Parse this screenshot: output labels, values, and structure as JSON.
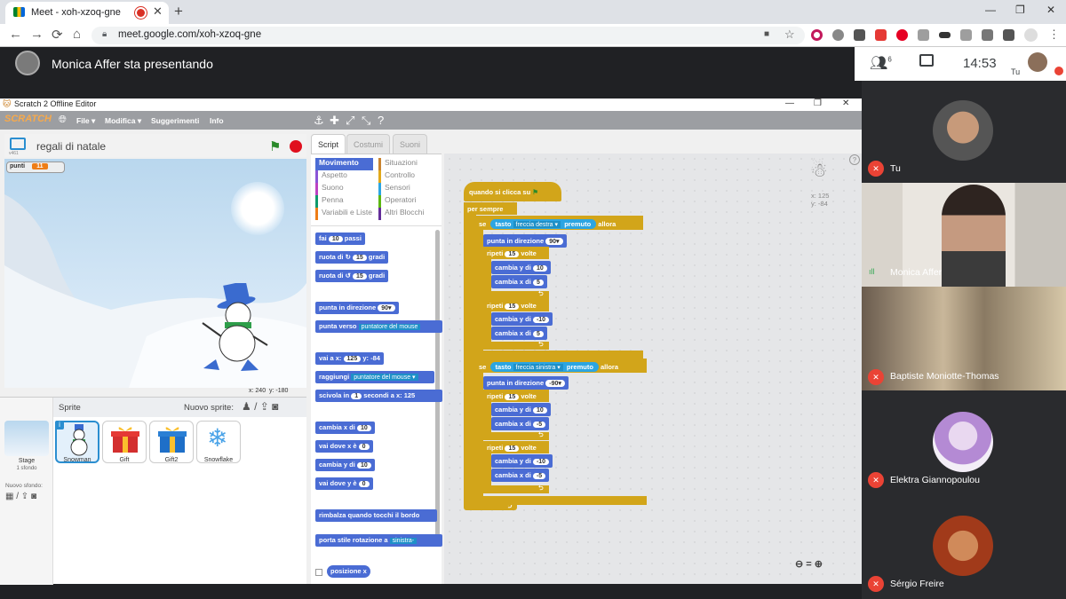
{
  "browser": {
    "tab_title": "Meet - xoh-xzoq-gne",
    "tab_close": "✕",
    "new_tab": "+",
    "url": "meet.google.com/xoh-xzoq-gne",
    "window_controls": [
      "—",
      "❐",
      "✕"
    ],
    "nav": [
      "←",
      "→",
      "⟳",
      "⌂"
    ]
  },
  "meet": {
    "presenting_text": "Monica Affer sta presentando",
    "participant_count": "6",
    "clock": "14:53",
    "self_label": "Tu",
    "participants": [
      {
        "name": "Tu",
        "muted": true
      },
      {
        "name": "Monica Affer",
        "muted": false
      },
      {
        "name": "Baptiste Moniotte-Thomas",
        "muted": true
      },
      {
        "name": "Elektra Giannopoulou",
        "muted": true
      },
      {
        "name": "Sérgio Freire",
        "muted": true
      }
    ]
  },
  "scratch": {
    "window_title": "Scratch 2 Offline Editor",
    "logo": "SCRATCH",
    "menus": [
      "File ▾",
      "Modifica ▾",
      "Suggerimenti",
      "Info"
    ],
    "project_name": "regali di natale",
    "version": "v461",
    "variable": {
      "name": "punti",
      "value": "11"
    },
    "stage_coords": {
      "x_label": "x:",
      "x": "240",
      "y_label": "y:",
      "y": "-180"
    },
    "sprite_header": "Sprite",
    "new_sprite": "Nuovo sprite:",
    "stage_label": "Stage",
    "stage_sub": "1 sfondo",
    "new_backdrop": "Nuovo sfondo:",
    "sprites": [
      "Snowman",
      "Gift",
      "Gift2",
      "Snowflake"
    ],
    "tabs": [
      "Script",
      "Costumi",
      "Suoni"
    ],
    "categories_left": [
      "Movimento",
      "Aspetto",
      "Suono",
      "Penna",
      "Variabili e Liste"
    ],
    "categories_right": [
      "Situazioni",
      "Controllo",
      "Sensori",
      "Operatori",
      "Altri Blocchi"
    ],
    "category_colors": {
      "Movimento": "#4a6cd4",
      "Aspetto": "#8a55d7",
      "Suono": "#bb42c3",
      "Penna": "#0e9a6c",
      "Variabili e Liste": "#ee7d16",
      "Situazioni": "#c88330",
      "Controllo": "#e1a91a",
      "Sensori": "#2ca5e2",
      "Operatori": "#5cb712",
      "Altri Blocchi": "#632d99"
    },
    "palette_blocks": [
      {
        "text": "fai",
        "input": "10",
        "suffix": "passi"
      },
      {
        "text": "ruota di ↻",
        "input": "15",
        "suffix": "gradi"
      },
      {
        "text": "ruota di ↺",
        "input": "15",
        "suffix": "gradi"
      },
      {
        "text": "punta in direzione",
        "input": "90▾",
        "suffix": ""
      },
      {
        "text": "punta verso",
        "input": "puntatore del mouse",
        "suffix": ""
      },
      {
        "text": "vai a x:",
        "input": "125",
        "suffix": "y: -84"
      },
      {
        "text": "raggiungi",
        "input": "puntatore del mouse ▾",
        "suffix": ""
      },
      {
        "text": "scivola in",
        "input": "1",
        "suffix": "secondi a x: 125"
      },
      {
        "text": "cambia x di",
        "input": "10",
        "suffix": ""
      },
      {
        "text": "vai dove x è",
        "input": "0",
        "suffix": ""
      },
      {
        "text": "cambia y di",
        "input": "10",
        "suffix": ""
      },
      {
        "text": "vai dove y è",
        "input": "0",
        "suffix": ""
      },
      {
        "text": "rimbalza quando tocchi il bordo",
        "input": "",
        "suffix": ""
      },
      {
        "text": "porta stile rotazione a",
        "input": "sinistra-",
        "suffix": ""
      },
      {
        "text": "posizione x",
        "input": "",
        "suffix": ""
      }
    ],
    "sprite_xy": {
      "x": "x: 125",
      "y": "y: -84"
    },
    "script": {
      "hat": "quando si clicca su",
      "forever": "per sempre",
      "if1": {
        "kw": "se",
        "sensor": "tasto",
        "key": "freccia destra ▾",
        "pressed": "premuto",
        "then": "allora",
        "point": "punta in direzione",
        "dir": "90▾",
        "rep1": {
          "label": "ripeti",
          "n": "15",
          "volte": "volte",
          "a": "cambia y di",
          "av": "10",
          "b": "cambia x di",
          "bv": "5"
        },
        "rep2": {
          "label": "ripeti",
          "n": "15",
          "volte": "volte",
          "a": "cambia y di",
          "av": "-10",
          "b": "cambia x di",
          "bv": "5"
        }
      },
      "if2": {
        "kw": "se",
        "sensor": "tasto",
        "key": "freccia sinistra ▾",
        "pressed": "premuto",
        "then": "allora",
        "point": "punta in direzione",
        "dir": "-90▾",
        "rep1": {
          "label": "ripeti",
          "n": "15",
          "volte": "volte",
          "a": "cambia y di",
          "av": "10",
          "b": "cambia x di",
          "bv": "-5"
        },
        "rep2": {
          "label": "ripeti",
          "n": "15",
          "volte": "volte",
          "a": "cambia y di",
          "av": "-10",
          "b": "cambia x di",
          "bv": "-5"
        }
      }
    },
    "zoom": [
      "⊖",
      "=",
      "⊕"
    ]
  }
}
